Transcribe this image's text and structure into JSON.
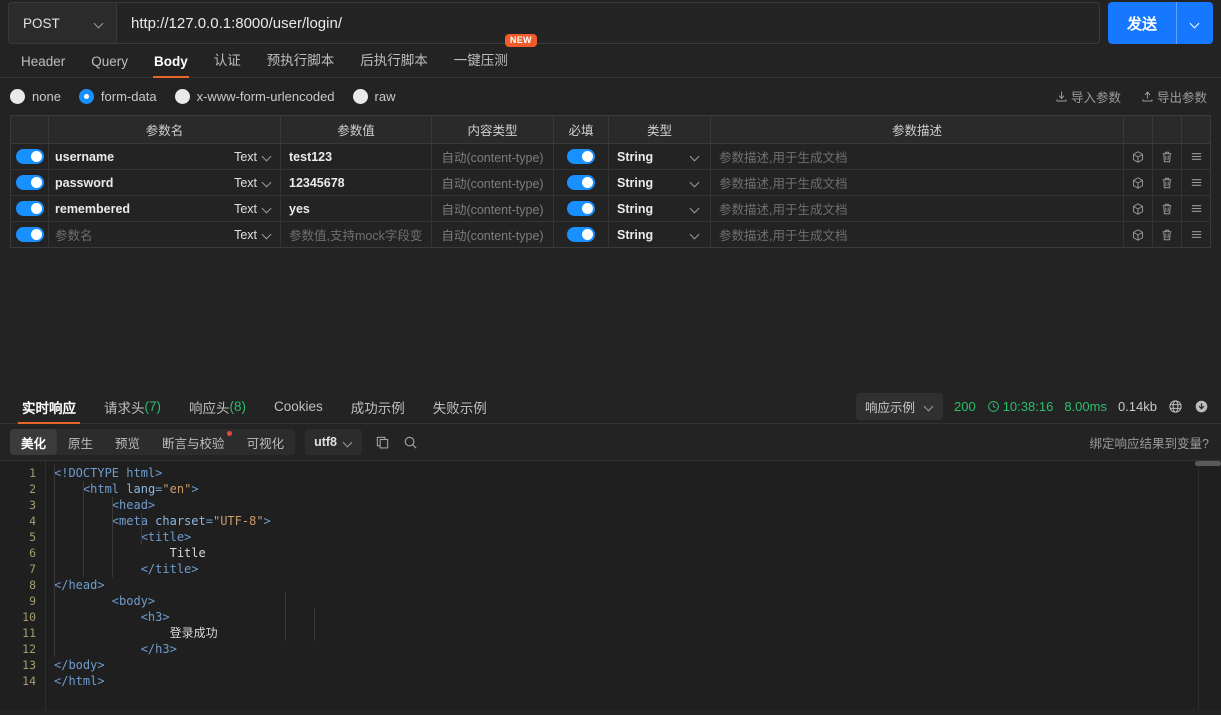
{
  "request": {
    "method": "POST",
    "url": "http://127.0.0.1:8000/user/login/",
    "send_label": "发送"
  },
  "request_tabs": [
    {
      "label": "Header",
      "active": false
    },
    {
      "label": "Query",
      "active": false
    },
    {
      "label": "Body",
      "active": true
    },
    {
      "label": "认证",
      "active": false
    },
    {
      "label": "预执行脚本",
      "active": false
    },
    {
      "label": "后执行脚本",
      "active": false
    },
    {
      "label": "一键压测",
      "active": false,
      "badge": "NEW"
    }
  ],
  "body_types": [
    {
      "label": "none",
      "selected": false
    },
    {
      "label": "form-data",
      "selected": true
    },
    {
      "label": "x-www-form-urlencoded",
      "selected": false
    },
    {
      "label": "raw",
      "selected": false
    }
  ],
  "io_actions": {
    "import": "导入参数",
    "export": "导出参数"
  },
  "table": {
    "headers": [
      "参数名",
      "参数值",
      "内容类型",
      "必填",
      "类型",
      "参数描述"
    ],
    "rows": [
      {
        "enabled": true,
        "name": "username",
        "name_placeholder": false,
        "datatype": "Text",
        "value": "test123",
        "value_placeholder": false,
        "content_type": "自动(content-type)",
        "required": true,
        "type": "String",
        "desc_placeholder": "参数描述,用于生成文档"
      },
      {
        "enabled": true,
        "name": "password",
        "name_placeholder": false,
        "datatype": "Text",
        "value": "12345678",
        "value_placeholder": false,
        "content_type": "自动(content-type)",
        "required": true,
        "type": "String",
        "desc_placeholder": "参数描述,用于生成文档"
      },
      {
        "enabled": true,
        "name": "remembered",
        "name_placeholder": false,
        "datatype": "Text",
        "value": "yes",
        "value_placeholder": false,
        "content_type": "自动(content-type)",
        "required": true,
        "type": "String",
        "desc_placeholder": "参数描述,用于生成文档"
      },
      {
        "enabled": true,
        "name": "参数名",
        "name_placeholder": true,
        "datatype": "Text",
        "value": "参数值,支持mock字段变",
        "value_placeholder": true,
        "content_type": "自动(content-type)",
        "required": true,
        "type": "String",
        "desc_placeholder": "参数描述,用于生成文档"
      }
    ]
  },
  "response_tabs": [
    {
      "label": "实时响应",
      "count": "",
      "active": true
    },
    {
      "label": "请求头",
      "count": "(7)",
      "active": false
    },
    {
      "label": "响应头",
      "count": "(8)",
      "active": false
    },
    {
      "label": "Cookies",
      "count": "",
      "active": false
    },
    {
      "label": "成功示例",
      "count": "",
      "active": false
    },
    {
      "label": "失败示例",
      "count": "",
      "active": false
    }
  ],
  "response_status": {
    "example_label": "响应示例",
    "code": "200",
    "time": "10:38:16",
    "duration": "8.00ms",
    "size": "0.14kb"
  },
  "view_tabs": [
    {
      "label": "美化",
      "active": true,
      "dot": false
    },
    {
      "label": "原生",
      "active": false,
      "dot": false
    },
    {
      "label": "预览",
      "active": false,
      "dot": false
    },
    {
      "label": "断言与校验",
      "active": false,
      "dot": true
    },
    {
      "label": "可视化",
      "active": false,
      "dot": false
    }
  ],
  "encoding": "utf8",
  "bind_variable_label": "绑定响应结果到变量?",
  "code_lines": [
    {
      "n": "1",
      "indent": 0,
      "tokens": [
        {
          "t": "tag",
          "s": "<!DOCTYPE html>"
        }
      ]
    },
    {
      "n": "2",
      "indent": 1,
      "tokens": [
        {
          "t": "tag",
          "s": "<html "
        },
        {
          "t": "attr",
          "s": "lang"
        },
        {
          "t": "tag",
          "s": "="
        },
        {
          "t": "val",
          "s": "\"en\""
        },
        {
          "t": "tag",
          "s": ">"
        }
      ]
    },
    {
      "n": "3",
      "indent": 2,
      "tokens": [
        {
          "t": "tag",
          "s": "<head>"
        }
      ]
    },
    {
      "n": "4",
      "indent": 2,
      "tokens": [
        {
          "t": "tag",
          "s": "<meta "
        },
        {
          "t": "attr",
          "s": "charset"
        },
        {
          "t": "tag",
          "s": "="
        },
        {
          "t": "val",
          "s": "\"UTF-8\""
        },
        {
          "t": "tag",
          "s": ">"
        }
      ]
    },
    {
      "n": "5",
      "indent": 3,
      "tokens": [
        {
          "t": "tag",
          "s": "<title>"
        }
      ]
    },
    {
      "n": "6",
      "indent": 4,
      "tokens": [
        {
          "t": "txt",
          "s": "Title"
        }
      ]
    },
    {
      "n": "7",
      "indent": 3,
      "tokens": [
        {
          "t": "tag",
          "s": "</title>"
        }
      ]
    },
    {
      "n": "8",
      "indent": 0,
      "tokens": [
        {
          "t": "tag",
          "s": "</head>"
        }
      ]
    },
    {
      "n": "9",
      "indent": 2,
      "tokens": [
        {
          "t": "tag",
          "s": "<body>"
        }
      ]
    },
    {
      "n": "10",
      "indent": 3,
      "tokens": [
        {
          "t": "tag",
          "s": "<h3>"
        }
      ]
    },
    {
      "n": "11",
      "indent": 4,
      "tokens": [
        {
          "t": "txt",
          "s": "登录成功"
        }
      ]
    },
    {
      "n": "12",
      "indent": 3,
      "tokens": [
        {
          "t": "tag",
          "s": "</h3>"
        }
      ]
    },
    {
      "n": "13",
      "indent": 0,
      "tokens": [
        {
          "t": "tag",
          "s": "</body>"
        }
      ]
    },
    {
      "n": "14",
      "indent": 0,
      "tokens": [
        {
          "t": "tag",
          "s": "</html>"
        }
      ]
    }
  ],
  "colors": {
    "accent_blue": "#1677ff",
    "tab_underline": "#e8662a",
    "success_green": "#2bbf6a",
    "badge_orange": "#ef5b2b",
    "bg": "#232323",
    "editor_bg": "#1f1f1f"
  }
}
